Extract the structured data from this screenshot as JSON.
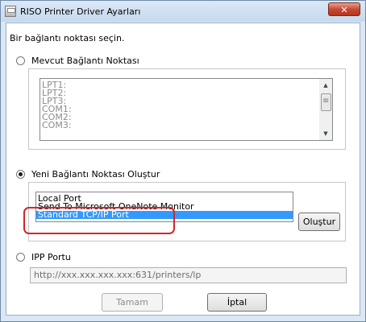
{
  "window": {
    "title": "RISO Printer Driver Ayarları",
    "close_glyph": "✕"
  },
  "instruction": "Bir bağlantı noktası seçin.",
  "existing_port": {
    "radio_label": "Mevcut Bağlantı Noktası",
    "checked": false,
    "items": [
      "LPT1:",
      "LPT2:",
      "LPT3:",
      "COM1:",
      "COM2:",
      "COM3:"
    ]
  },
  "new_port": {
    "radio_label": "Yeni Bağlantı Noktası Oluştur",
    "checked": true,
    "items": [
      "Local Port",
      "Send To Microsoft OneNote Monitor",
      "Standard TCP/IP Port"
    ],
    "selected_index": 2,
    "create_button": "Oluştur"
  },
  "ipp_port": {
    "radio_label": "IPP Portu",
    "checked": false,
    "url": "http://xxx.xxx.xxx.xxx:631/printers/lp"
  },
  "buttons": {
    "ok": "Tamam",
    "cancel": "İptal"
  },
  "colors": {
    "selection": "#3399ff",
    "highlight_oval": "#d4252a",
    "close_button": "#c64a32"
  }
}
